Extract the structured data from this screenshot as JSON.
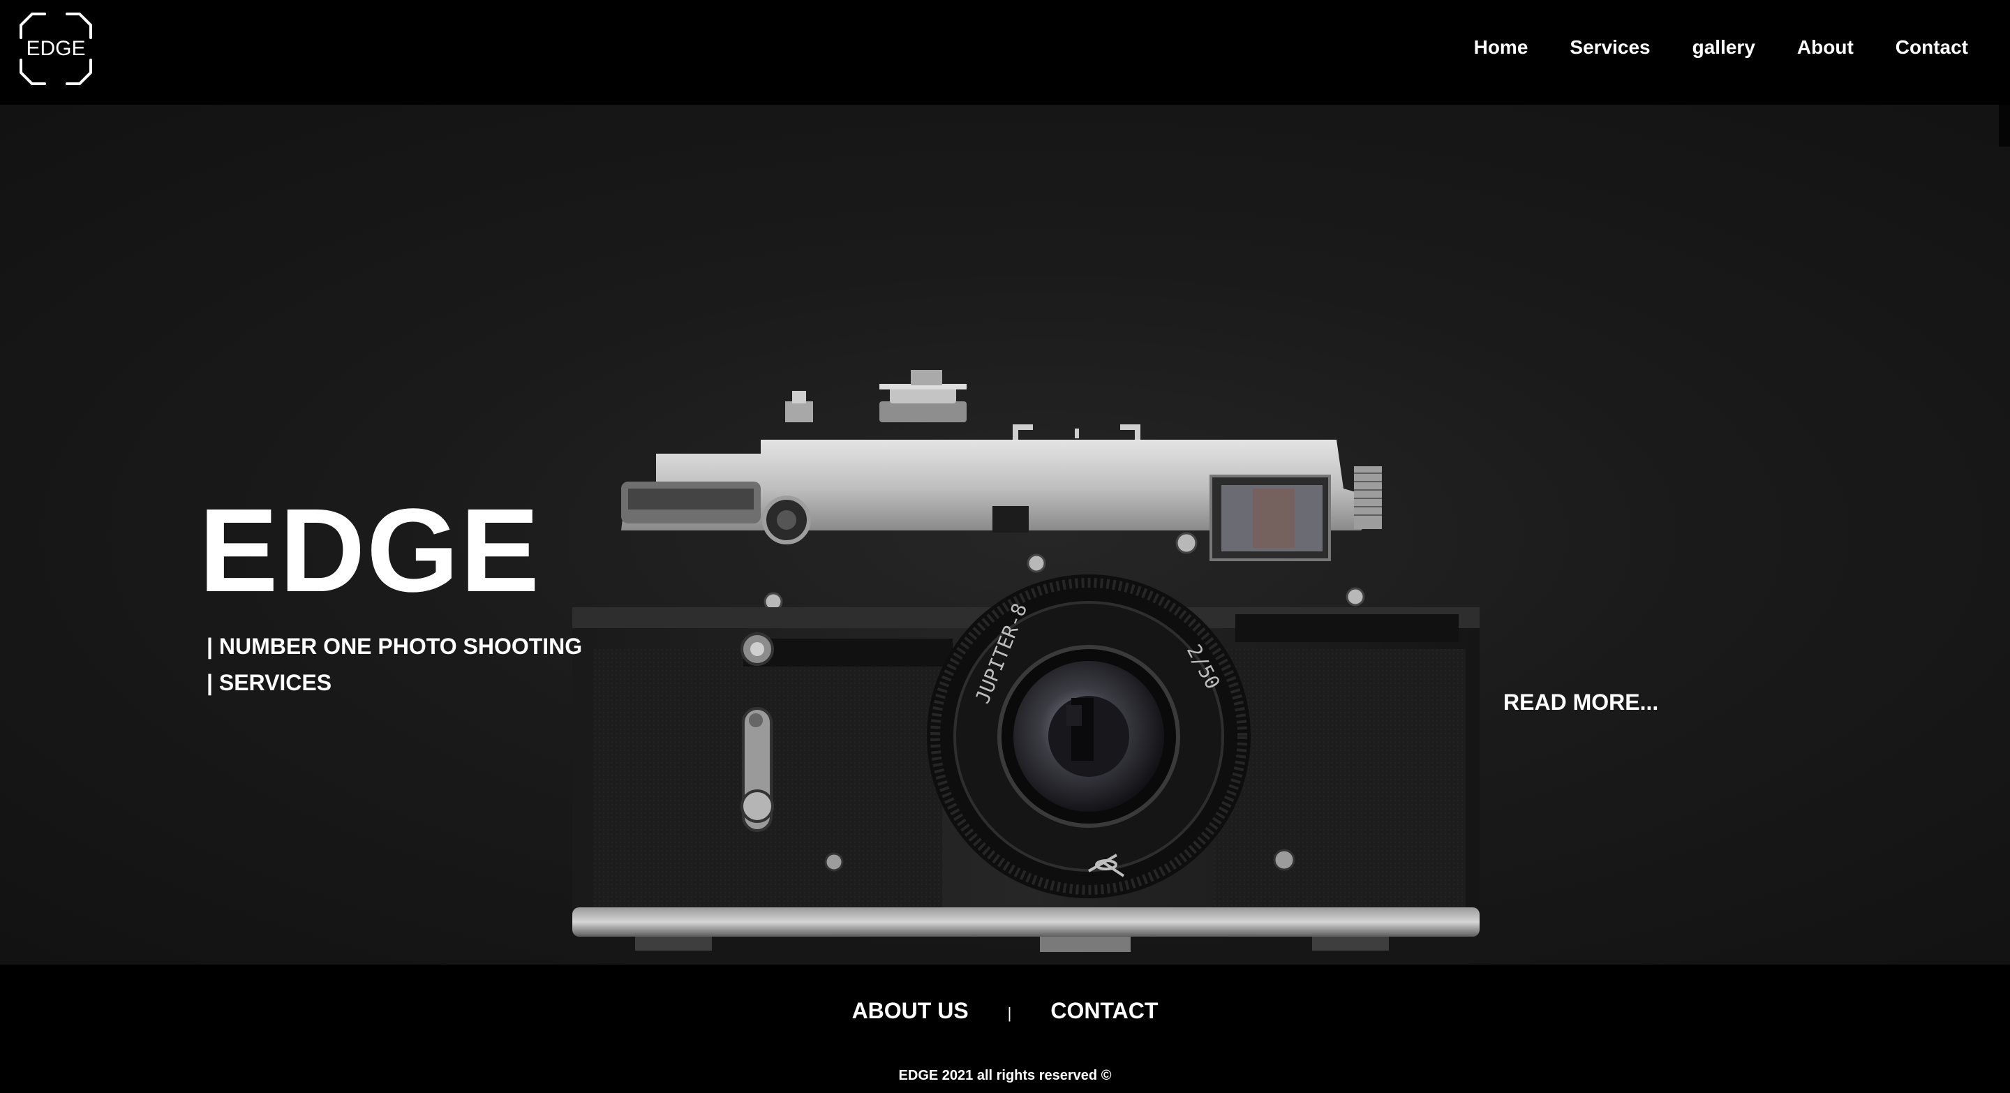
{
  "header": {
    "logo_text": "EDGE",
    "nav": [
      {
        "label": "Home"
      },
      {
        "label": "Services"
      },
      {
        "label": "gallery"
      },
      {
        "label": "About"
      },
      {
        "label": "Contact"
      }
    ]
  },
  "hero": {
    "title": "EDGE",
    "tagline_line1": "| NUMBER ONE PHOTO SHOOTING",
    "tagline_line2": "| SERVICES",
    "read_more": "READ MORE...",
    "lens_text_left": "JUPITER-8",
    "lens_text_right": "2/50"
  },
  "footer": {
    "about_label": "ABOUT US",
    "separator": "|",
    "contact_label": "CONTACT",
    "copyright": "EDGE 2021 all rights reserved ©"
  },
  "colors": {
    "page_background": "#000000",
    "hero_background": "#1a1a1a",
    "text": "#ffffff"
  }
}
